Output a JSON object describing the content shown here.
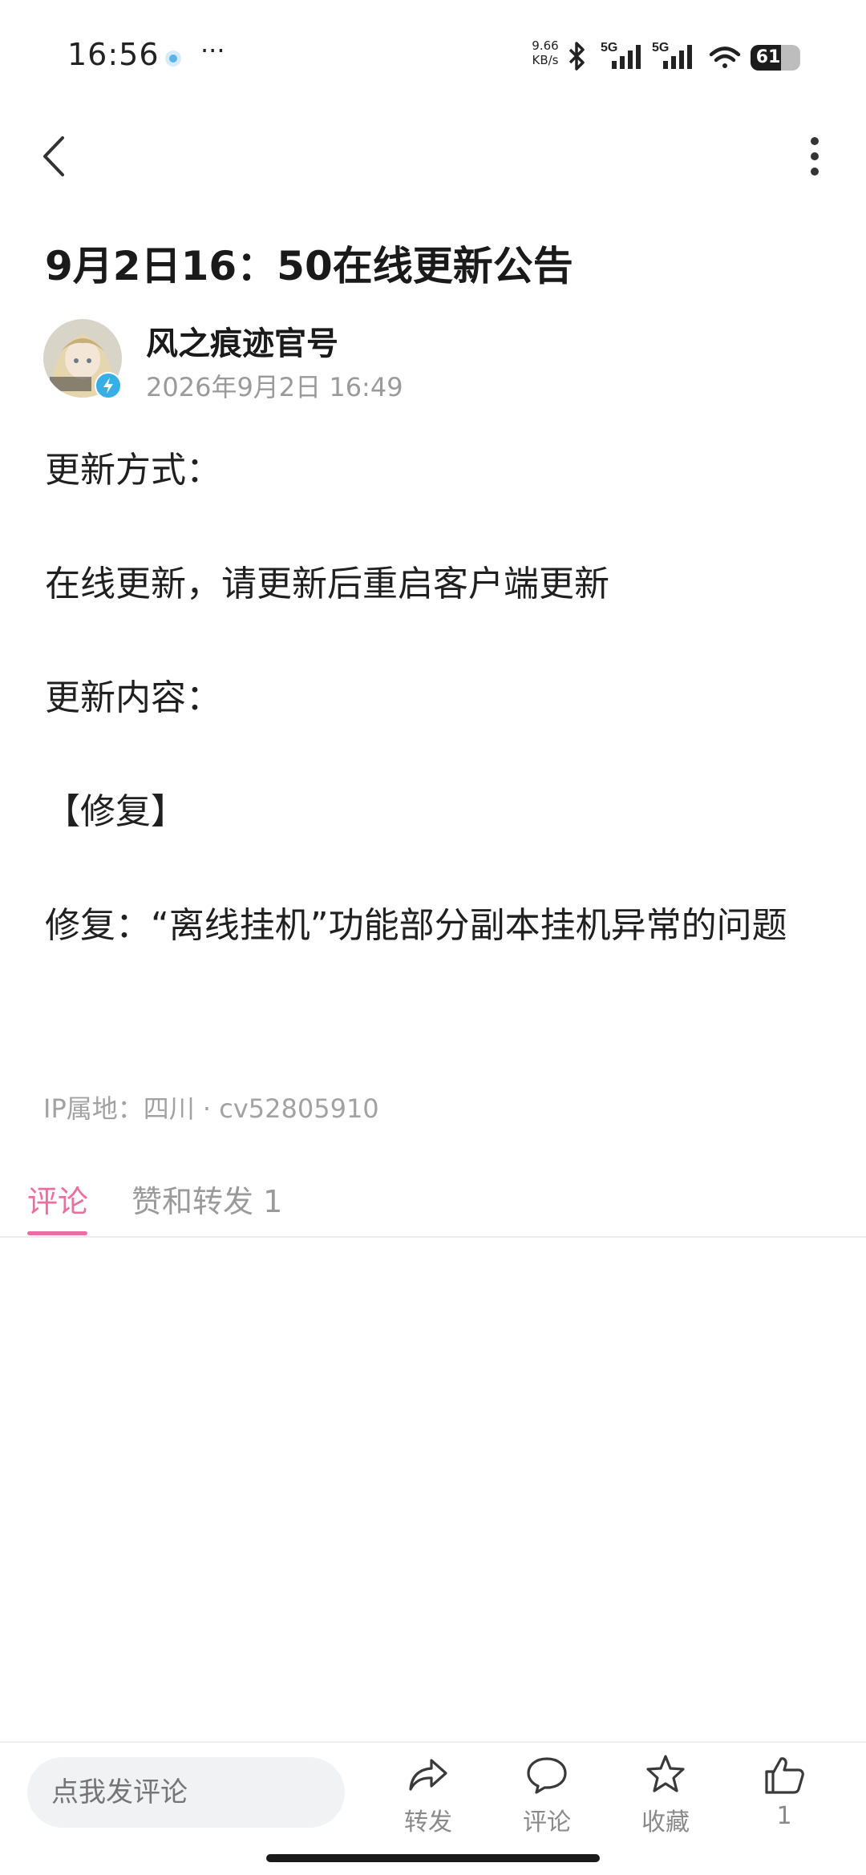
{
  "status_bar": {
    "time": "16:56",
    "more": "···",
    "net_speed_value": "9.66",
    "net_speed_unit": "KB/s",
    "network_1": "5G",
    "network_2": "5G",
    "battery_level": "61"
  },
  "post": {
    "title": "9月2日16：50在线更新公告",
    "author": "风之痕迹官号",
    "date": "2026年9月2日 16:49",
    "body": [
      "更新方式：",
      "在线更新，请更新后重启客户端更新",
      "更新内容：",
      "【修复】",
      "修复：“离线挂机”功能部分副本挂机异常的问题"
    ],
    "meta": "IP属地：四川 · cv52805910"
  },
  "tabs": {
    "comments": "评论",
    "likes_reposts": "赞和转发 1"
  },
  "bottom_bar": {
    "comment_placeholder": "点我发评论",
    "repost": "转发",
    "comment": "评论",
    "favorite": "收藏",
    "like_count": "1"
  },
  "colors": {
    "accent": "#ea6fa0",
    "verified": "#37aee6"
  }
}
